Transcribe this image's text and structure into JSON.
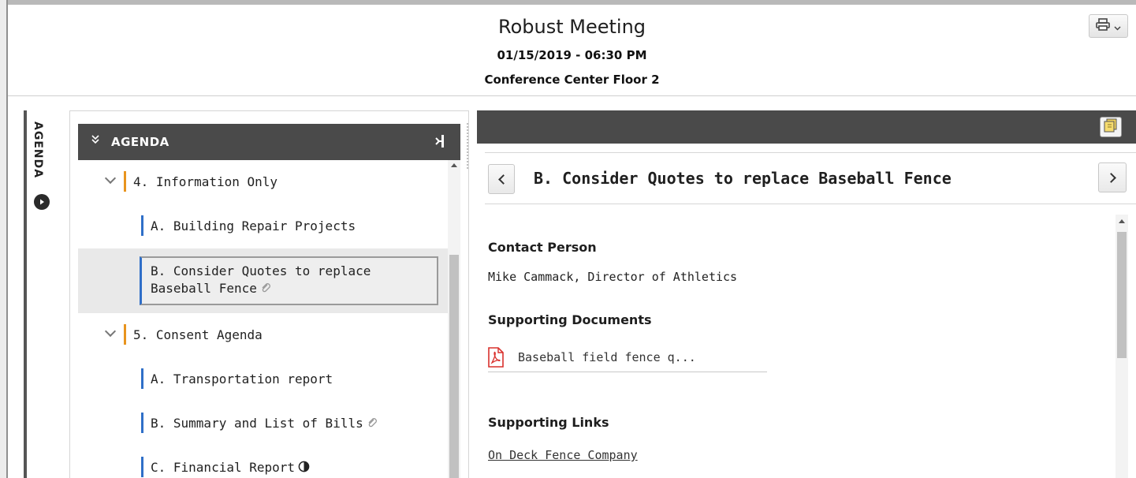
{
  "meeting": {
    "title": "Robust Meeting",
    "datetime": "01/15/2019 - 06:30 PM",
    "location": "Conference Center Floor 2"
  },
  "toolbar": {
    "print_icon": "printer-icon",
    "print_dropdown_icon": "chevron-down-icon"
  },
  "side_tab": {
    "label": "AGENDA",
    "icon": "play-circle-icon"
  },
  "agenda": {
    "header": "AGENDA",
    "header_icon": "double-chevron-down-icon",
    "collapse_icon": "collapse-panel-icon",
    "sections": [
      {
        "label": "4. Information Only",
        "items": [
          {
            "label": "A. Building Repair Projects"
          },
          {
            "label": "B. Consider Quotes to replace Baseball Fence",
            "icon": "attachment-icon",
            "selected": true
          }
        ]
      },
      {
        "label": "5. Consent Agenda",
        "items": [
          {
            "label": "A. Transportation report"
          },
          {
            "label": "B. Summary and List of Bills",
            "icon": "attachment-icon"
          },
          {
            "label": "C. Financial Report",
            "icon": "half-circle-icon"
          }
        ]
      }
    ]
  },
  "detail": {
    "notes_icon": "sticky-notes-icon",
    "title": "B. Consider Quotes to replace Baseball Fence",
    "contact_heading": "Contact Person",
    "contact_value": "Mike Cammack, Director of Athletics",
    "documents_heading": "Supporting Documents",
    "document_name": "Baseball field fence q...",
    "document_icon": "pdf-icon",
    "links_heading": "Supporting Links",
    "link_label": "On Deck Fence Company"
  },
  "colors": {
    "section_accent": "#e8941e",
    "item_accent": "#2f6fc8",
    "header_dark": "#4a4a4a",
    "pdf_red": "#d9302c"
  }
}
